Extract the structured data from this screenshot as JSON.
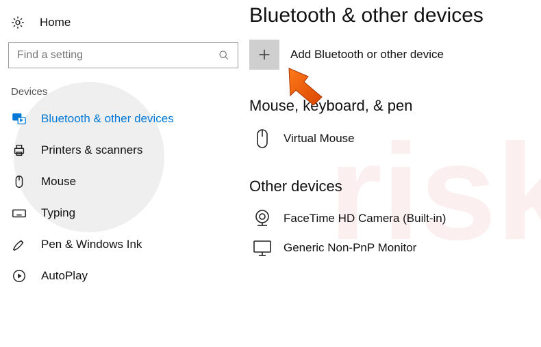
{
  "sidebar": {
    "home_label": "Home",
    "search_placeholder": "Find a setting",
    "category_label": "Devices",
    "items": [
      {
        "label": "Bluetooth & other devices"
      },
      {
        "label": "Printers & scanners"
      },
      {
        "label": "Mouse"
      },
      {
        "label": "Typing"
      },
      {
        "label": "Pen & Windows Ink"
      },
      {
        "label": "AutoPlay"
      }
    ]
  },
  "main": {
    "title": "Bluetooth & other devices",
    "add_label": "Add Bluetooth or other device",
    "sections": [
      {
        "title": "Mouse, keyboard, & pen",
        "devices": [
          {
            "label": "Virtual Mouse"
          }
        ]
      },
      {
        "title": "Other devices",
        "devices": [
          {
            "label": "FaceTime HD Camera (Built-in)"
          },
          {
            "label": "Generic Non-PnP Monitor"
          }
        ]
      }
    ]
  }
}
